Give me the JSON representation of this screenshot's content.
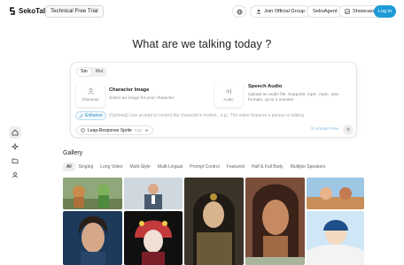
{
  "header": {
    "brand": "SekoTalk",
    "trial_tag": "Technical Free Trial",
    "lang_icon": "language-icon",
    "join_group": "Join Official Group",
    "seko_agent": "SekoAgent",
    "showcase": "Showcase",
    "login": "Log in"
  },
  "rail": {
    "items": [
      "home-icon",
      "sparkle-icon",
      "folder-icon",
      "user-icon"
    ]
  },
  "main": {
    "headline": "What are we talking today ?"
  },
  "composer": {
    "mode_tabs": [
      "Sin",
      "Mul"
    ],
    "active_mode": "Sin",
    "character": {
      "slot_label": "Character",
      "title": "Character Image",
      "desc": "Select an image for your character"
    },
    "audio": {
      "slot_label": "Audio",
      "title": "Speech Audio",
      "desc": "Upload an audio file. Supports: mp4, .mp3, .wav formats, up to 2 minutes"
    },
    "enhance_label": "Enhance",
    "prompt_placeholder": "(Optional) Use prompt to control the character's motion , e.g.: The video features a person is talking",
    "model": {
      "name": "Leap-Response Sprite",
      "sub": "Fast"
    },
    "free_label": "Limited Free"
  },
  "gallery": {
    "title": "Gallery",
    "chips": [
      "All",
      "Singing",
      "Long Video",
      "Multi-Style",
      "Multi-Lingual",
      "Prompt Control",
      "Featured",
      "Half & Full Body",
      "Multiple Speakers"
    ],
    "active_chip": "All"
  },
  "colors": {
    "accent": "#1e9bd7",
    "chip_active_bg": "#eeeeee",
    "border": "#e6e6e6"
  }
}
